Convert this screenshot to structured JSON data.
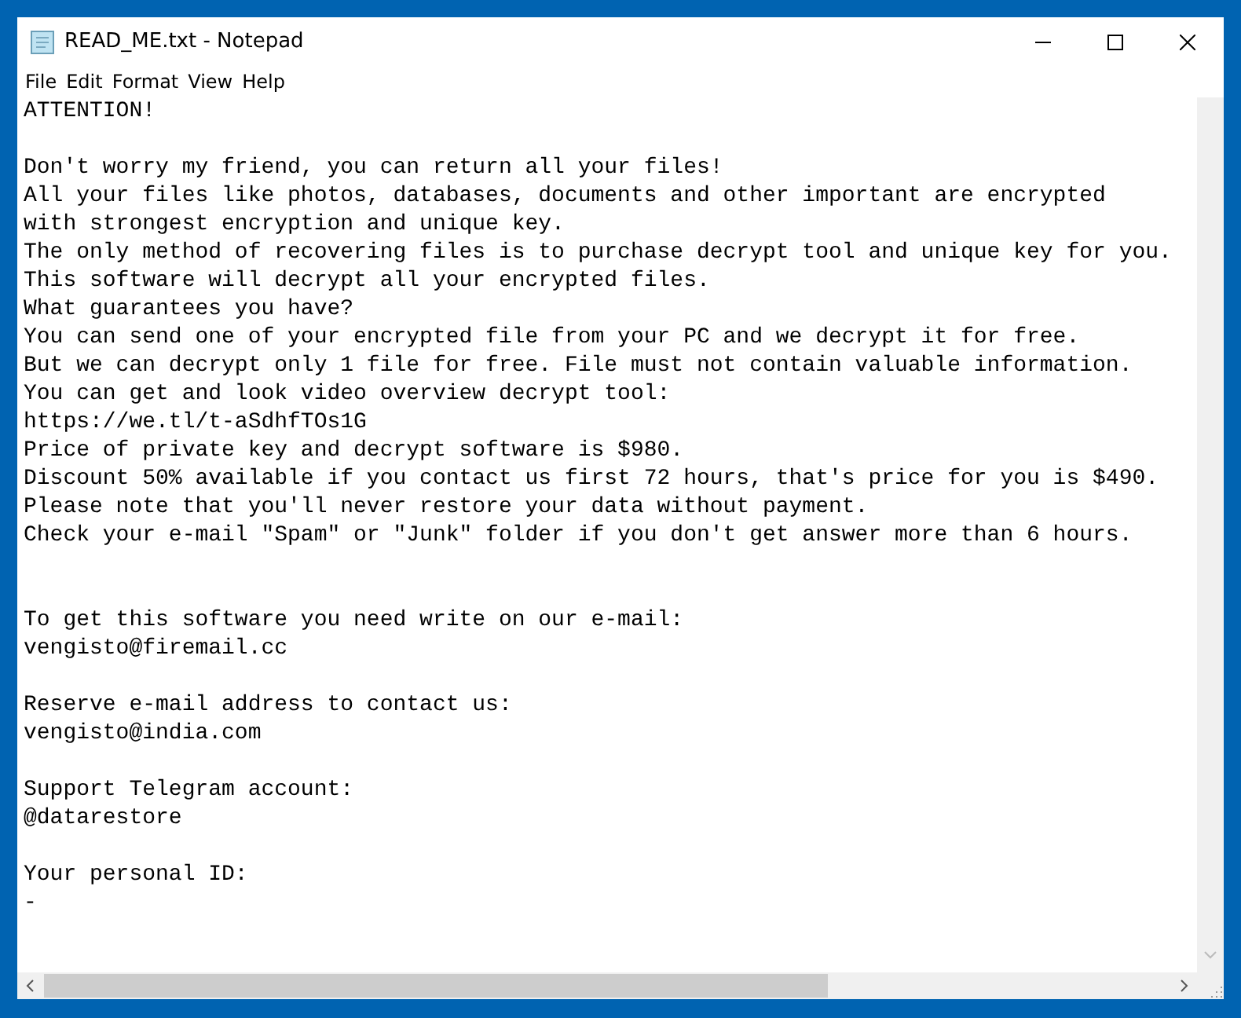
{
  "window": {
    "title": "READ_ME.txt - Notepad"
  },
  "menu": [
    "File",
    "Edit",
    "Format",
    "View",
    "Help"
  ],
  "lines": [
    {
      "kind": "text",
      "text": "ATTENTION!"
    },
    {
      "kind": "blank"
    },
    {
      "kind": "text",
      "text": "Don't worry my friend, you can return all your files!"
    },
    {
      "kind": "text",
      "text": "All your files like photos, databases, documents and other important are encrypted"
    },
    {
      "kind": "text",
      "text": "with strongest encryption and unique key."
    },
    {
      "kind": "text",
      "text": "The only method of recovering files is to purchase decrypt tool and unique key for you."
    },
    {
      "kind": "text",
      "text": "This software will decrypt all your encrypted files."
    },
    {
      "kind": "text",
      "text": "What guarantees you have?"
    },
    {
      "kind": "text",
      "text": "You can send one of your encrypted file from your PC and we decrypt it for free."
    },
    {
      "kind": "text",
      "text": "But we can decrypt only 1 file for free. File must not contain valuable information."
    },
    {
      "kind": "text",
      "text": "You can get and look video overview decrypt tool:"
    },
    {
      "kind": "text",
      "text": "https://we.tl/t-aSdhfTOs1G"
    },
    {
      "kind": "text",
      "text": "Price of private key and decrypt software is $980."
    },
    {
      "kind": "text",
      "text": "Discount 50% available if you contact us first 72 hours, that's price for you is $490."
    },
    {
      "kind": "text",
      "text": "Please note that you'll never restore your data without payment."
    },
    {
      "kind": "text",
      "text": "Check your e-mail \"Spam\" or \"Junk\" folder if you don't get answer more than 6 hours."
    },
    {
      "kind": "blank"
    },
    {
      "kind": "blank"
    },
    {
      "kind": "text",
      "text": "To get this software you need write on our e-mail:"
    },
    {
      "kind": "text",
      "text": "vengisto@firemail.cc"
    },
    {
      "kind": "blank"
    },
    {
      "kind": "text",
      "text": "Reserve e-mail address to contact us:"
    },
    {
      "kind": "text",
      "text": "vengisto@india.com"
    },
    {
      "kind": "blank"
    },
    {
      "kind": "text",
      "text": "Support Telegram account:"
    },
    {
      "kind": "text",
      "text": "@datarestore"
    },
    {
      "kind": "blank"
    },
    {
      "kind": "text",
      "text": "Your personal ID:"
    },
    {
      "kind": "text",
      "text": "-"
    }
  ]
}
